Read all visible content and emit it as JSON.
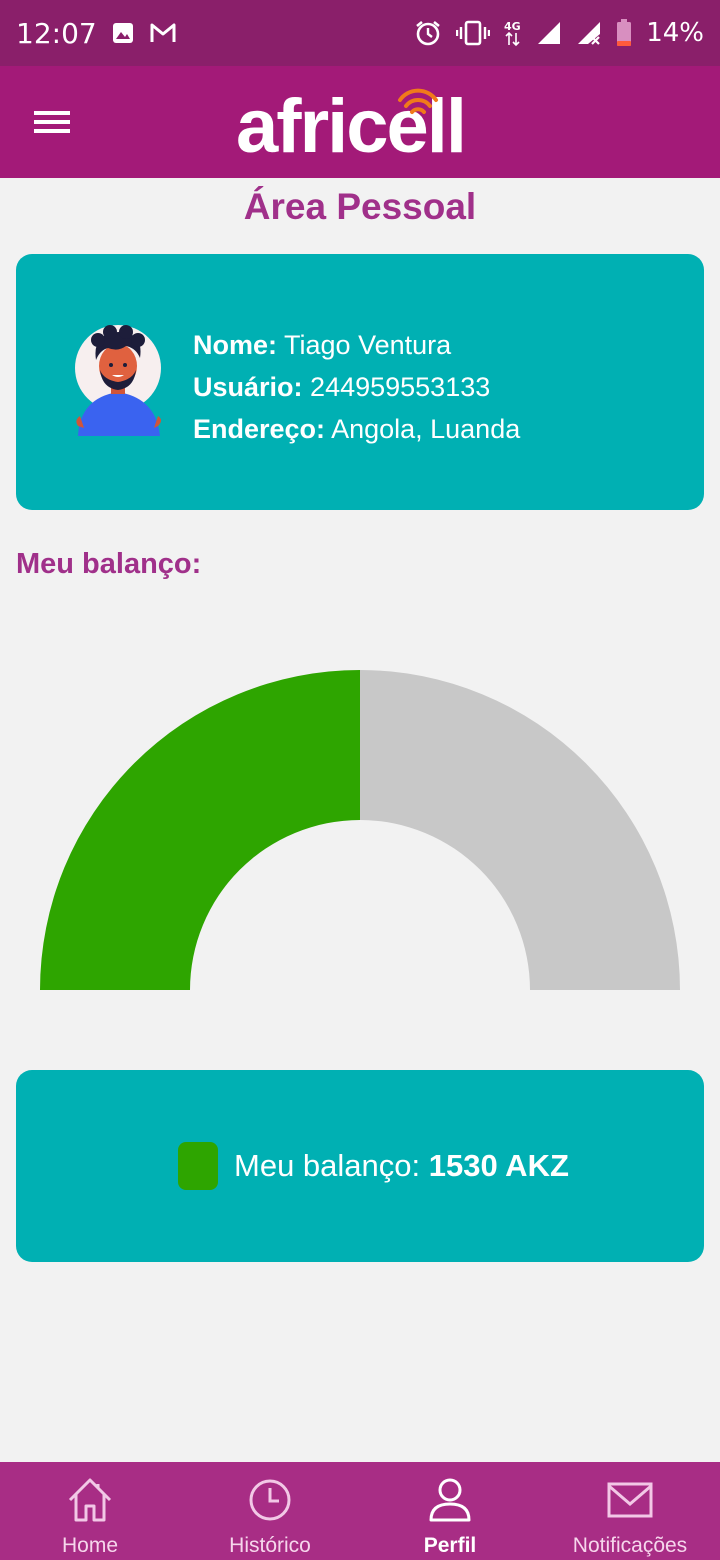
{
  "status_bar": {
    "time": "12:07",
    "battery_percent": "14%",
    "icons": [
      "image-icon",
      "gmail-icon",
      "alarm-icon",
      "vibrate-icon",
      "4g-icon",
      "signal-icon",
      "signal-x-icon",
      "battery-icon"
    ]
  },
  "app_bar": {
    "logo_text": "africell",
    "menu_icon": "hamburger-menu-icon"
  },
  "page": {
    "title": "Área Pessoal"
  },
  "profile": {
    "name_label": "Nome:",
    "name_value": "Tiago Ventura",
    "user_label": "Usuário:",
    "user_value": "244959553133",
    "address_label": "Endereço:",
    "address_value": "Angola, Luanda",
    "avatar_icon": "user-avatar-icon"
  },
  "balance": {
    "heading": "Meu balanço:",
    "legend_label": "Meu balanço:",
    "legend_value": "1530 AKZ"
  },
  "chart_data": {
    "type": "gauge",
    "filled_fraction": 0.5,
    "colors": {
      "filled": "#2ea500",
      "remaining": "#c8c8c8"
    }
  },
  "colors": {
    "status_bar": "#8a1f6a",
    "app_bar": "#a31a78",
    "accent_text": "#a0308a",
    "card": "#00b0b3",
    "bottom_nav": "#a82d85",
    "logo_waves": "#f07a1a"
  },
  "bottom_nav": {
    "items": [
      {
        "label": "Home",
        "icon": "home-icon"
      },
      {
        "label": "Histórico",
        "icon": "clock-icon"
      },
      {
        "label": "Perfil",
        "icon": "person-icon",
        "active": true
      },
      {
        "label": "Notificações",
        "icon": "envelope-icon"
      }
    ]
  }
}
